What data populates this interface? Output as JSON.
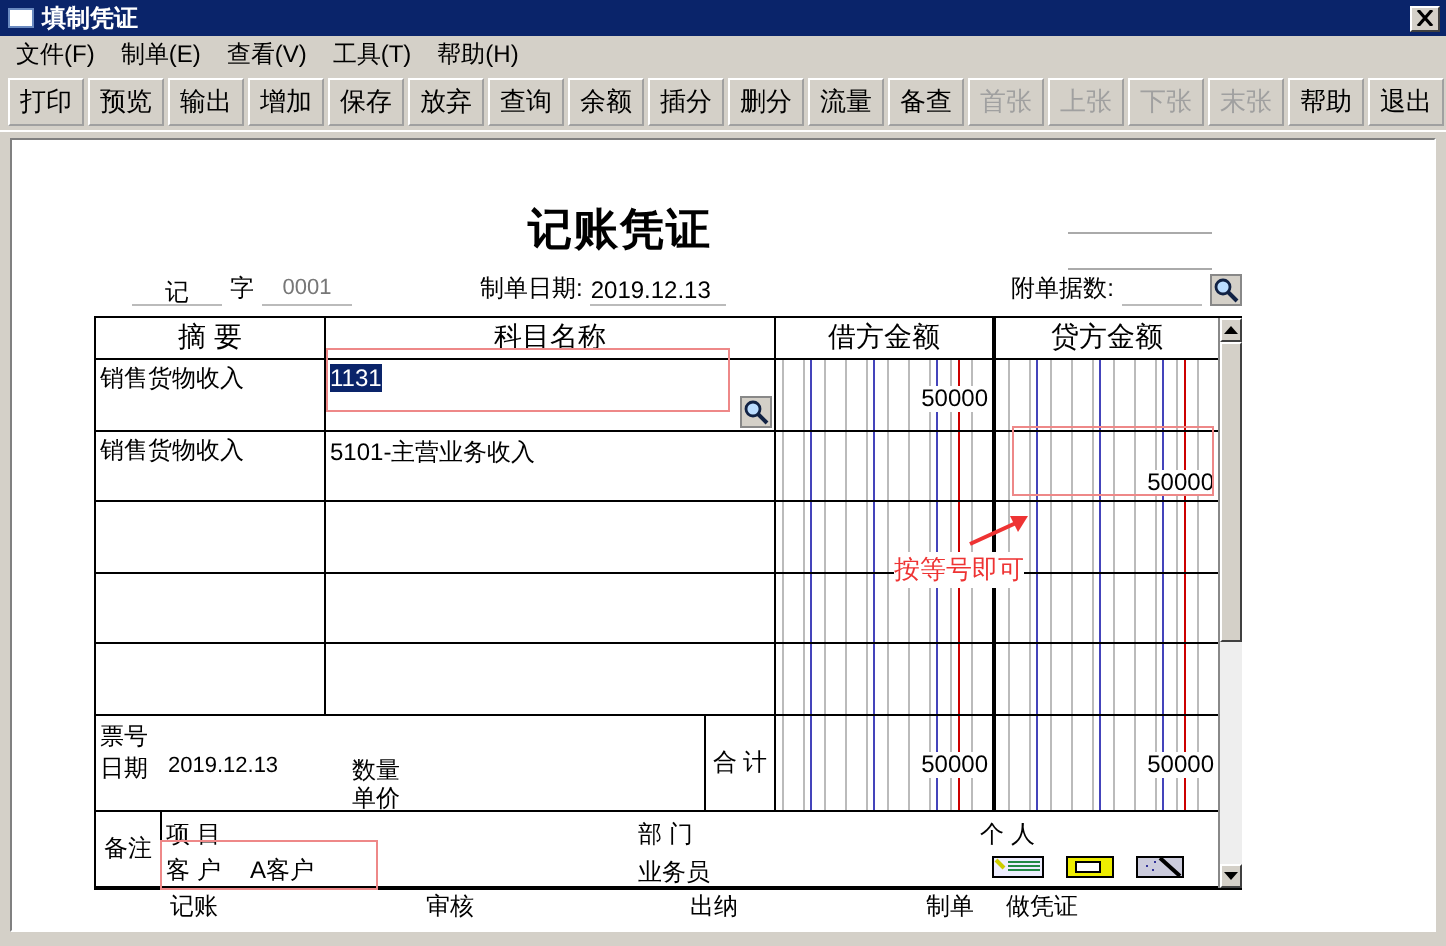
{
  "window": {
    "title": "填制凭证"
  },
  "menu": [
    "文件(F)",
    "制单(E)",
    "查看(V)",
    "工具(T)",
    "帮助(H)"
  ],
  "toolbar": [
    {
      "label": "打印",
      "disabled": false
    },
    {
      "label": "预览",
      "disabled": false
    },
    {
      "label": "输出",
      "disabled": false
    },
    {
      "label": "增加",
      "disabled": false
    },
    {
      "label": "保存",
      "disabled": false
    },
    {
      "label": "放弃",
      "disabled": false
    },
    {
      "label": "查询",
      "disabled": false
    },
    {
      "label": "余额",
      "disabled": false
    },
    {
      "label": "插分",
      "disabled": false
    },
    {
      "label": "删分",
      "disabled": false
    },
    {
      "label": "流量",
      "disabled": false
    },
    {
      "label": "备查",
      "disabled": false
    },
    {
      "label": "首张",
      "disabled": true
    },
    {
      "label": "上张",
      "disabled": true
    },
    {
      "label": "下张",
      "disabled": true
    },
    {
      "label": "末张",
      "disabled": true
    },
    {
      "label": "帮助",
      "disabled": false
    },
    {
      "label": "退出",
      "disabled": false
    }
  ],
  "voucher": {
    "title": "记账凭证",
    "type": "记",
    "type_suffix": "字",
    "number": "0001",
    "date_label": "制单日期:",
    "date": "2019.12.13",
    "attachments_label": "附单据数:",
    "columns": [
      "摘 要",
      "科目名称",
      "借方金额",
      "贷方金额"
    ],
    "rows": [
      {
        "summary": "销售货物收入",
        "account": "1131",
        "account_selected": true,
        "debit": "50000"
      },
      {
        "summary": "销售货物收入",
        "account": "5101-主营业务收入",
        "account_selected": false,
        "credit": "50000"
      }
    ],
    "footer": {
      "ticket_label": "票号",
      "date_label": "日期",
      "date": "2019.12.13",
      "quantity_label": "数量",
      "price_label": "单价",
      "total_label": "合 计",
      "debit_total": "50000",
      "credit_total": "50000"
    },
    "remarks": {
      "label": "备注",
      "project_label": "项 目",
      "customer_label": "客 户",
      "customer": "A客户",
      "department_label": "部 门",
      "salesperson_label": "业务员",
      "person_label": "个 人"
    },
    "signatures": [
      "记账",
      "审核",
      "出纳",
      "制单",
      "做凭证"
    ]
  },
  "annotation": {
    "note": "按等号即可"
  }
}
